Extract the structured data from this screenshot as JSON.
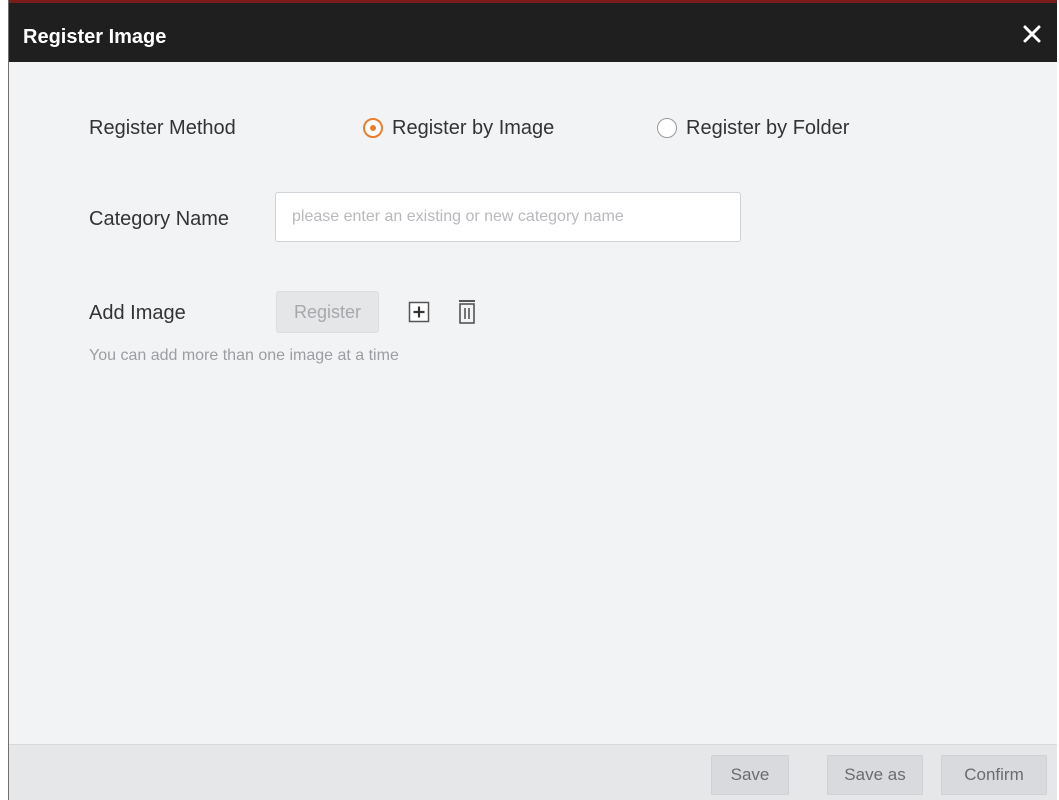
{
  "dialog": {
    "title": "Register Image",
    "close_icon": "close-icon"
  },
  "register_method": {
    "label": "Register Method",
    "options": [
      {
        "label": "Register by Image",
        "selected": true
      },
      {
        "label": "Register by Folder",
        "selected": false
      }
    ]
  },
  "category": {
    "label": "Category Name",
    "value": "",
    "placeholder": "please enter an existing or new category name"
  },
  "add_image": {
    "label": "Add Image",
    "register_label": "Register",
    "add_icon": "plus-icon",
    "delete_icon": "trash-icon",
    "hint": "You can add more than one image at a time"
  },
  "footer": {
    "save_label": "Save",
    "save_as_label": "Save as",
    "confirm_label": "Confirm"
  },
  "colors": {
    "titlebar": "#1f1f1f",
    "accent": "#ea7d2b",
    "background": "#f2f3f5"
  }
}
